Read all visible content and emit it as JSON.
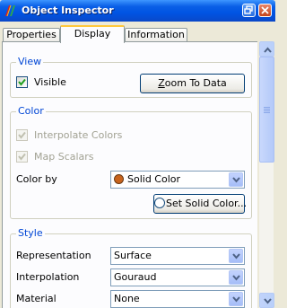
{
  "window": {
    "title": "Object Inspector"
  },
  "tabs": [
    {
      "label": "Properties"
    },
    {
      "label": "Display"
    },
    {
      "label": "Information"
    }
  ],
  "view": {
    "group_title": "View",
    "visible_label": "Visible",
    "visible_checked": true,
    "zoom_button_label": "Zoom To Data"
  },
  "color": {
    "group_title": "Color",
    "interpolate_label": "Interpolate Colors",
    "interpolate_checked": true,
    "map_scalars_label": "Map Scalars",
    "map_scalars_checked": true,
    "color_by_label": "Color by",
    "color_by_value": "Solid Color",
    "swatch_color": "#c8641e",
    "set_solid_color_label": "Set Solid Color..."
  },
  "style": {
    "group_title": "Style",
    "representation_label": "Representation",
    "representation_value": "Surface",
    "interpolation_label": "Interpolation",
    "interpolation_value": "Gouraud",
    "material_label": "Material",
    "material_value": "None"
  }
}
